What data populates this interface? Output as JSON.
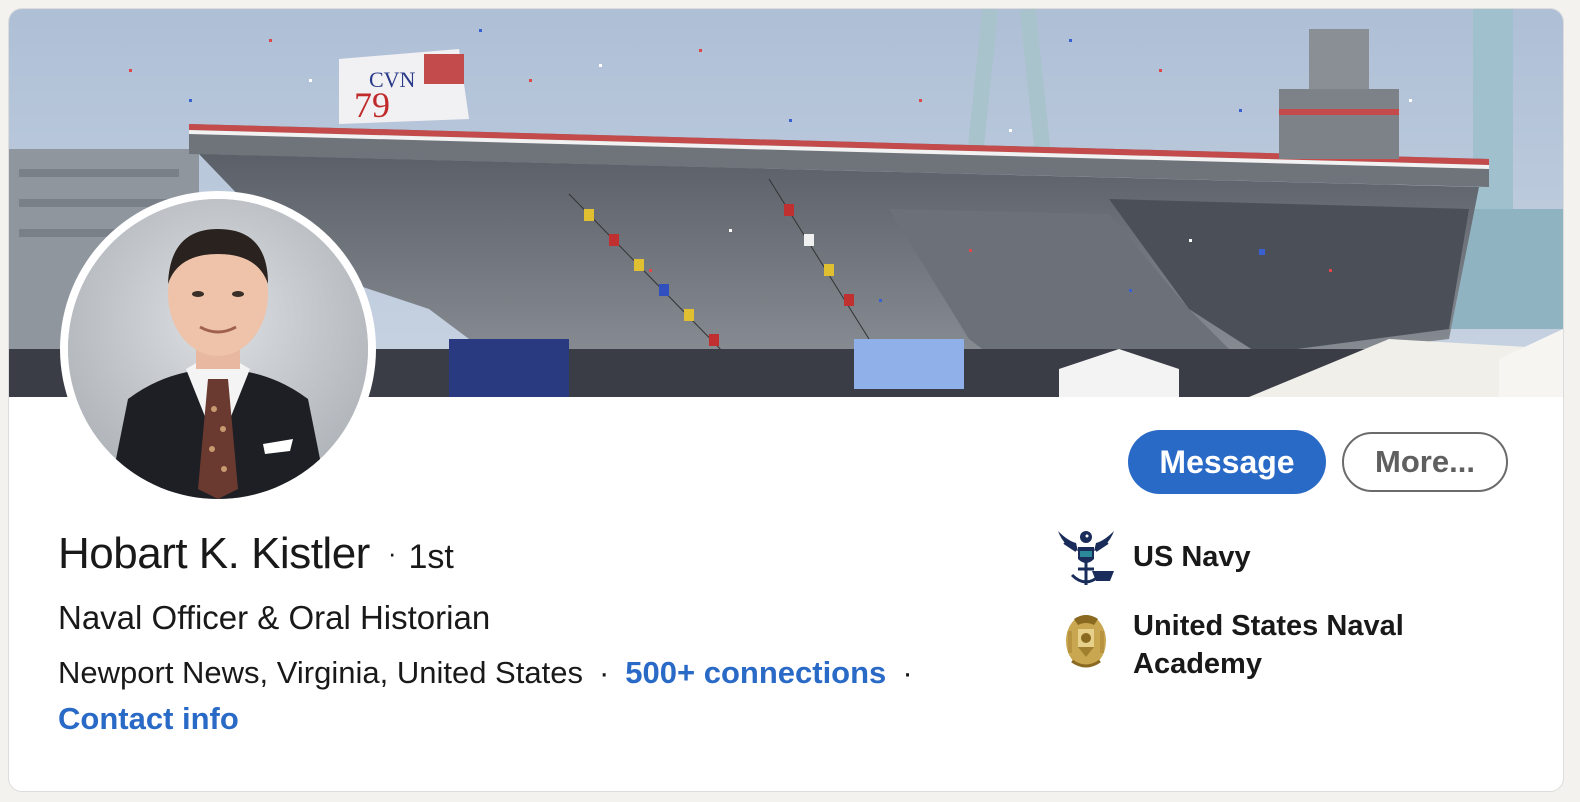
{
  "profile": {
    "name": "Hobart K. Kistler",
    "degree_separator": "·",
    "degree": "1st",
    "headline": "Naval Officer & Oral Historian",
    "location": "Newport News, Virginia, United States",
    "separator": "·",
    "connections": "500+ connections",
    "contact_info": "Contact info"
  },
  "banner": {
    "hull_marking_line1": "CVN",
    "hull_marking_line2": "79"
  },
  "actions": {
    "message_label": "Message",
    "more_label": "More..."
  },
  "organizations": [
    {
      "name": "US Navy",
      "logo_icon": "navy-eagle-icon"
    },
    {
      "name_line1": "United States Naval",
      "name_line2": "Academy",
      "logo_icon": "naval-academy-crest-icon"
    }
  ],
  "colors": {
    "accent": "#2a6ac7",
    "text": "#191919",
    "secondary_button_text": "#5f5f5f"
  }
}
